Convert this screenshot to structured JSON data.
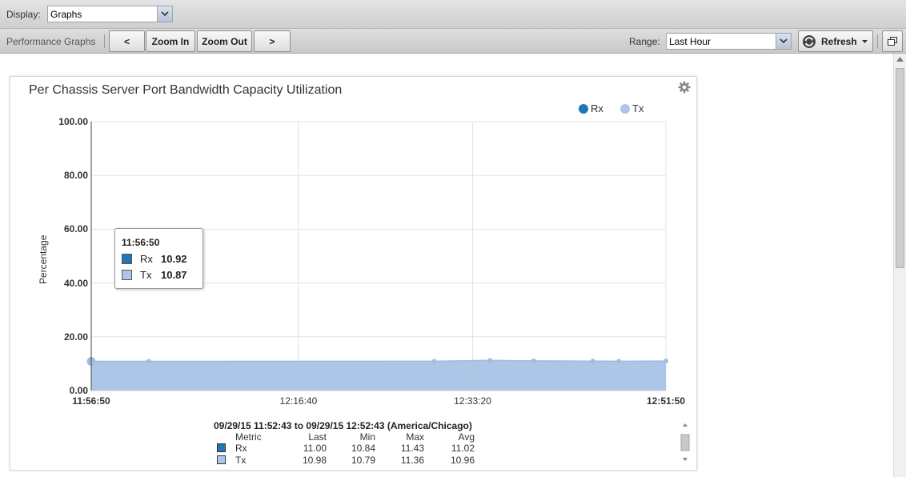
{
  "toolbar": {
    "display_label": "Display:",
    "display_value": "Graphs",
    "section_label": "Performance Graphs",
    "buttons": {
      "prev": "<",
      "zoom_in": "Zoom In",
      "zoom_out": "Zoom Out",
      "next": ">"
    },
    "range_label": "Range:",
    "range_value": "Last Hour",
    "refresh_label": "Refresh"
  },
  "chart_data": {
    "type": "area",
    "title": "Per Chassis Server Port Bandwidth Capacity Utilization",
    "ylabel": "Percentage",
    "ylim": [
      0,
      100
    ],
    "yticks": [
      "0.00",
      "20.00",
      "40.00",
      "60.00",
      "80.00",
      "100.00"
    ],
    "xticks": [
      "11:56:50",
      "12:16:40",
      "12:33:20",
      "12:51:50"
    ],
    "xtick_seconds": [
      0,
      1190,
      2190,
      3300
    ],
    "grid": true,
    "legend_position": "top-right",
    "series": [
      {
        "name": "Rx",
        "color": "#1f77b4",
        "x": [
          0,
          330,
          1970,
          2290,
          2540,
          2880,
          3030,
          3300
        ],
        "values": [
          10.92,
          10.9,
          10.95,
          11.3,
          11.1,
          11.0,
          10.95,
          11.0
        ]
      },
      {
        "name": "Tx",
        "color": "#aec7e8",
        "x": [
          0,
          330,
          1970,
          2290,
          2540,
          2880,
          3030,
          3300
        ],
        "values": [
          10.87,
          10.85,
          10.9,
          11.2,
          11.0,
          10.95,
          10.9,
          10.98
        ]
      }
    ],
    "tooltip": {
      "time": "11:56:50",
      "rx": "10.92",
      "tx": "10.87"
    }
  },
  "summary": {
    "range": "09/29/15 11:52:43 to 09/29/15 12:52:43 (America/Chicago)",
    "headers": [
      "Metric",
      "Last",
      "Min",
      "Max",
      "Avg"
    ],
    "rows": [
      {
        "name": "Rx",
        "color": "#1f77b4",
        "last": "11.00",
        "min": "10.84",
        "max": "11.43",
        "avg": "11.02"
      },
      {
        "name": "Tx",
        "color": "#aec7e8",
        "last": "10.98",
        "min": "10.79",
        "max": "11.36",
        "avg": "10.96"
      }
    ]
  }
}
